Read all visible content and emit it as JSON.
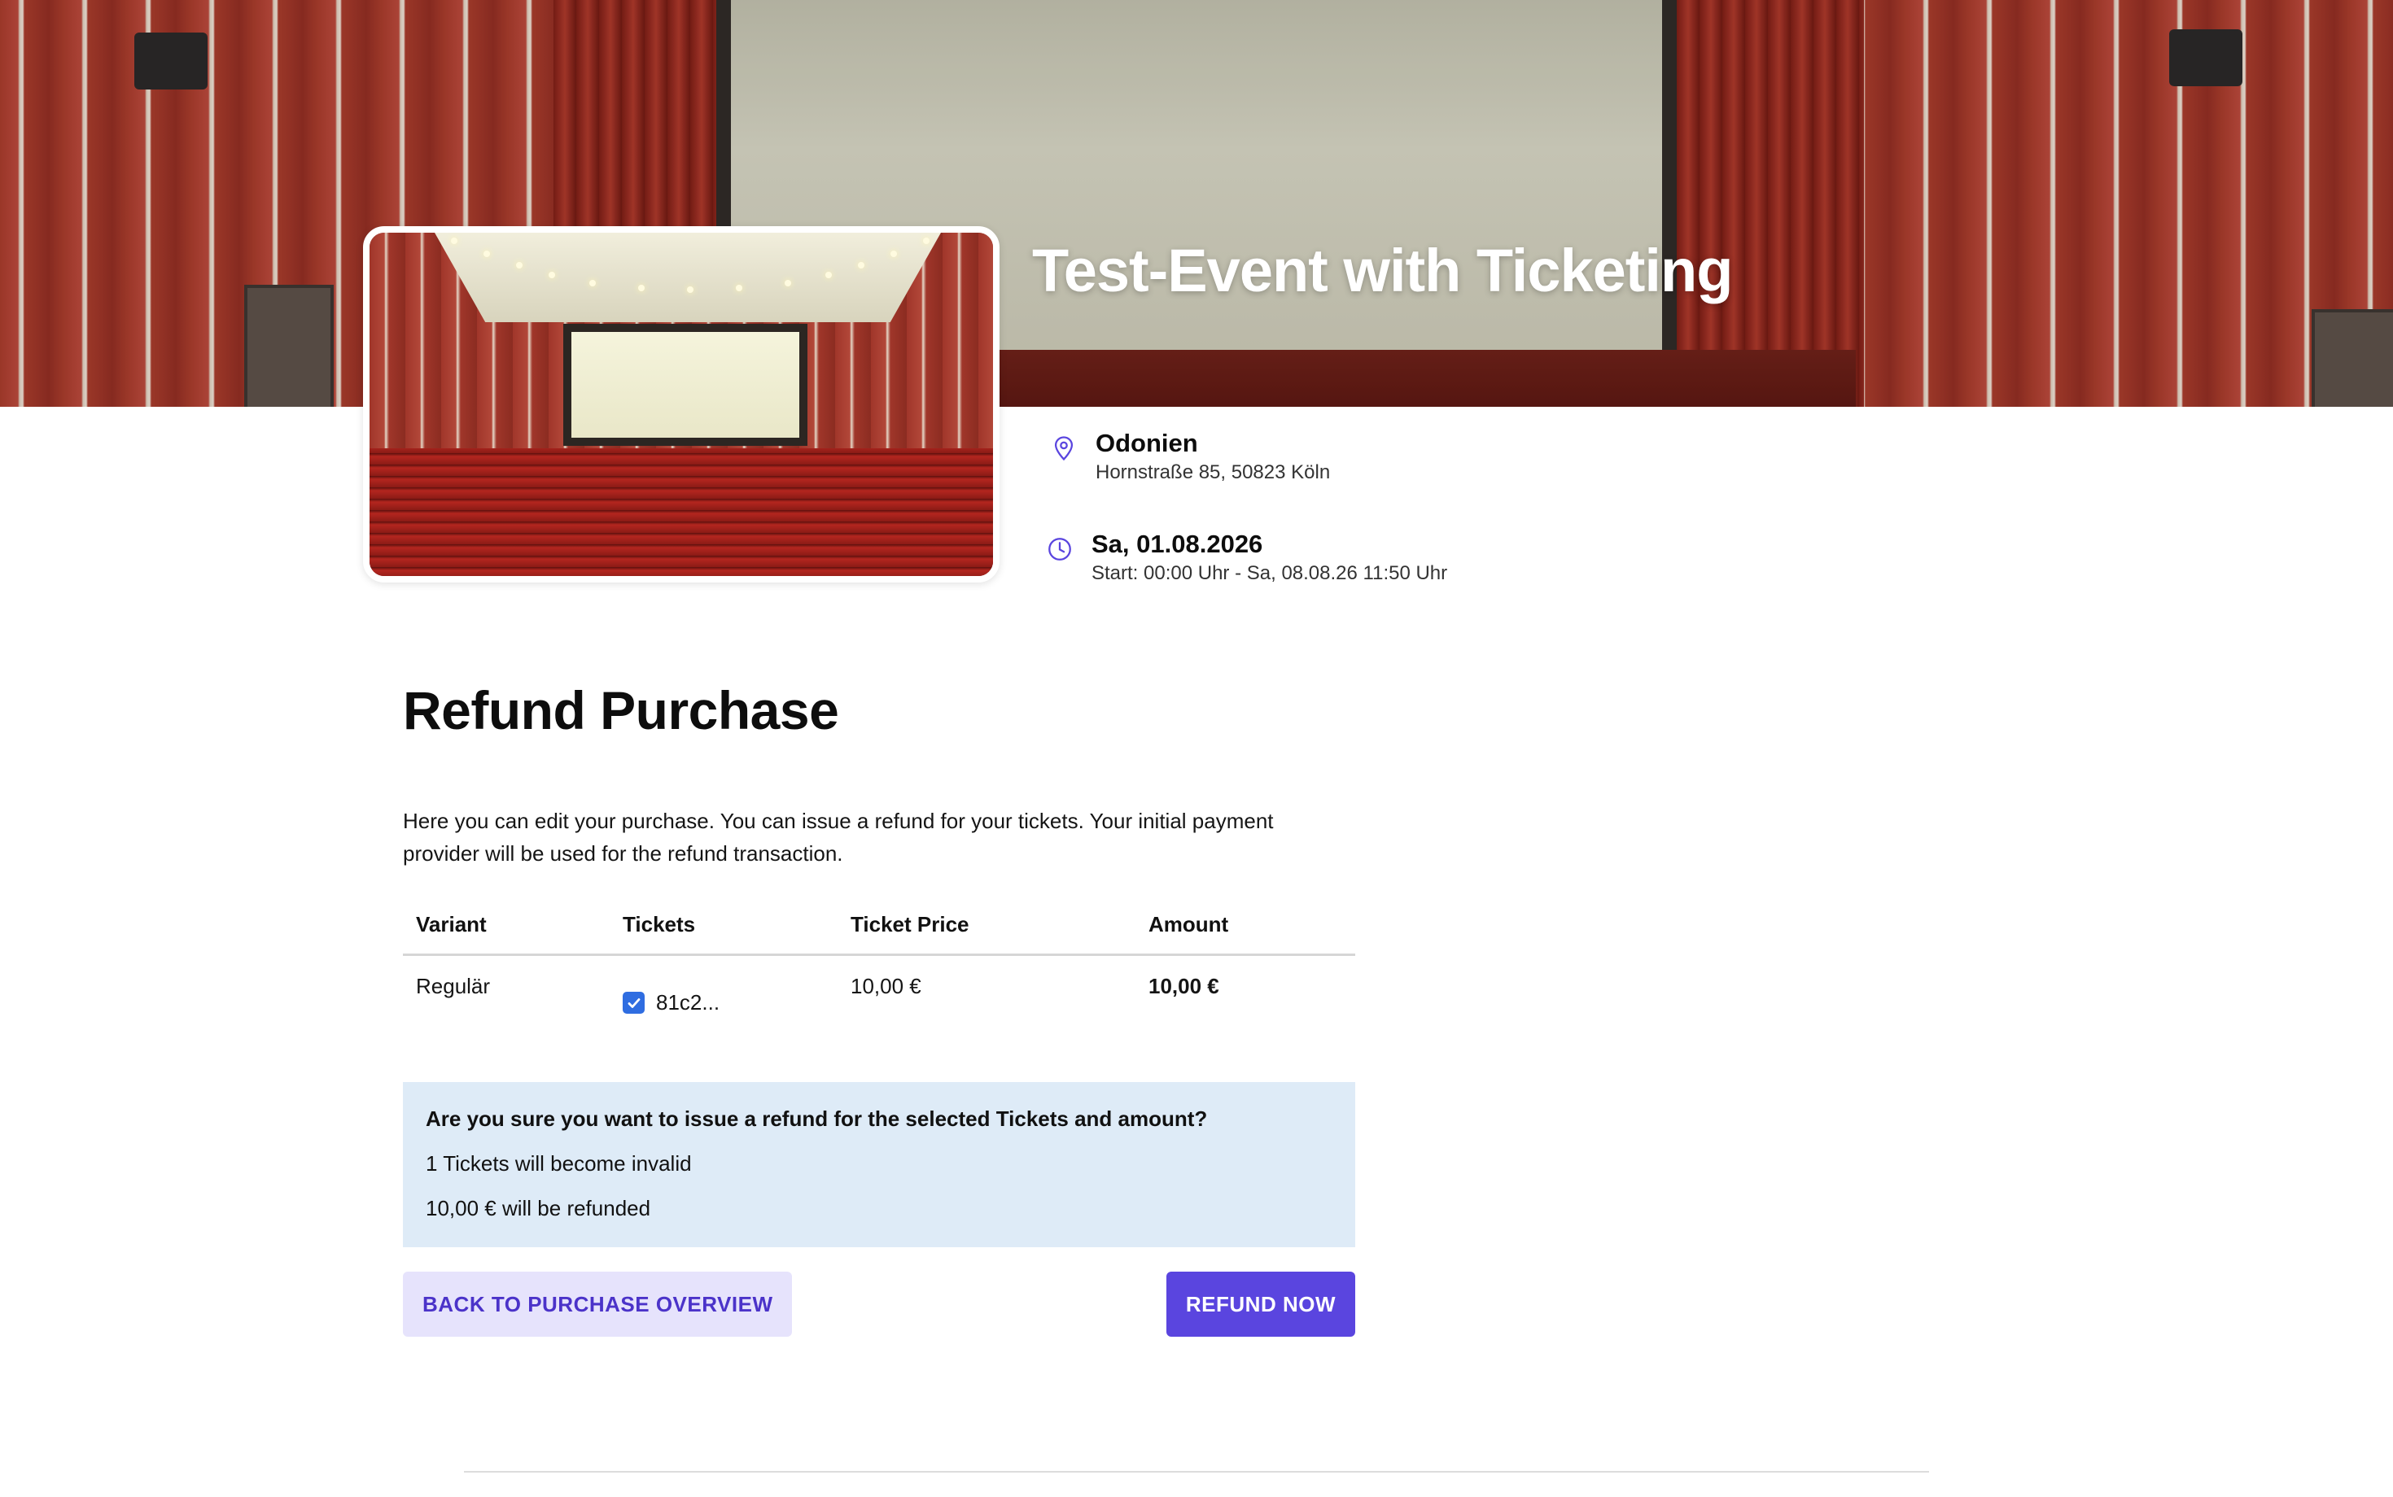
{
  "event": {
    "title": "Test-Event with Ticketing",
    "venue_name": "Odonien",
    "venue_address": "Hornstraße 85, 50823 Köln",
    "date": "Sa, 01.08.2026",
    "time_range": "Start: 00:00 Uhr - Sa, 08.08.26 11:50 Uhr"
  },
  "icons": {
    "location": "map-pin-icon",
    "time": "clock-icon",
    "accent_color": "#5a45df"
  },
  "refund": {
    "title": "Refund Purchase",
    "intro": "Here you can edit your purchase. You can issue a refund for your tickets. Your initial payment provider will be used for the refund transaction.",
    "table": {
      "headers": [
        "Variant",
        "Tickets",
        "Ticket Price",
        "Amount"
      ],
      "rows": [
        {
          "variant": "Regulär",
          "ticket_id": "81c2...",
          "ticket_checked": true,
          "price": "10,00 €",
          "amount": "10,00 €"
        }
      ]
    },
    "confirm": {
      "question": "Are you sure you want to issue a refund for the selected Tickets and amount?",
      "invalid_line": "1 Tickets will become invalid",
      "refund_line": "10,00 € will be refunded"
    },
    "buttons": {
      "back": "BACK TO PURCHASE OVERVIEW",
      "refund": "REFUND NOW"
    }
  },
  "colors": {
    "primary": "#5a45df",
    "secondary_bg": "#e6e3fc",
    "confirm_bg": "#deebf7",
    "checkbox": "#2f6de1"
  }
}
